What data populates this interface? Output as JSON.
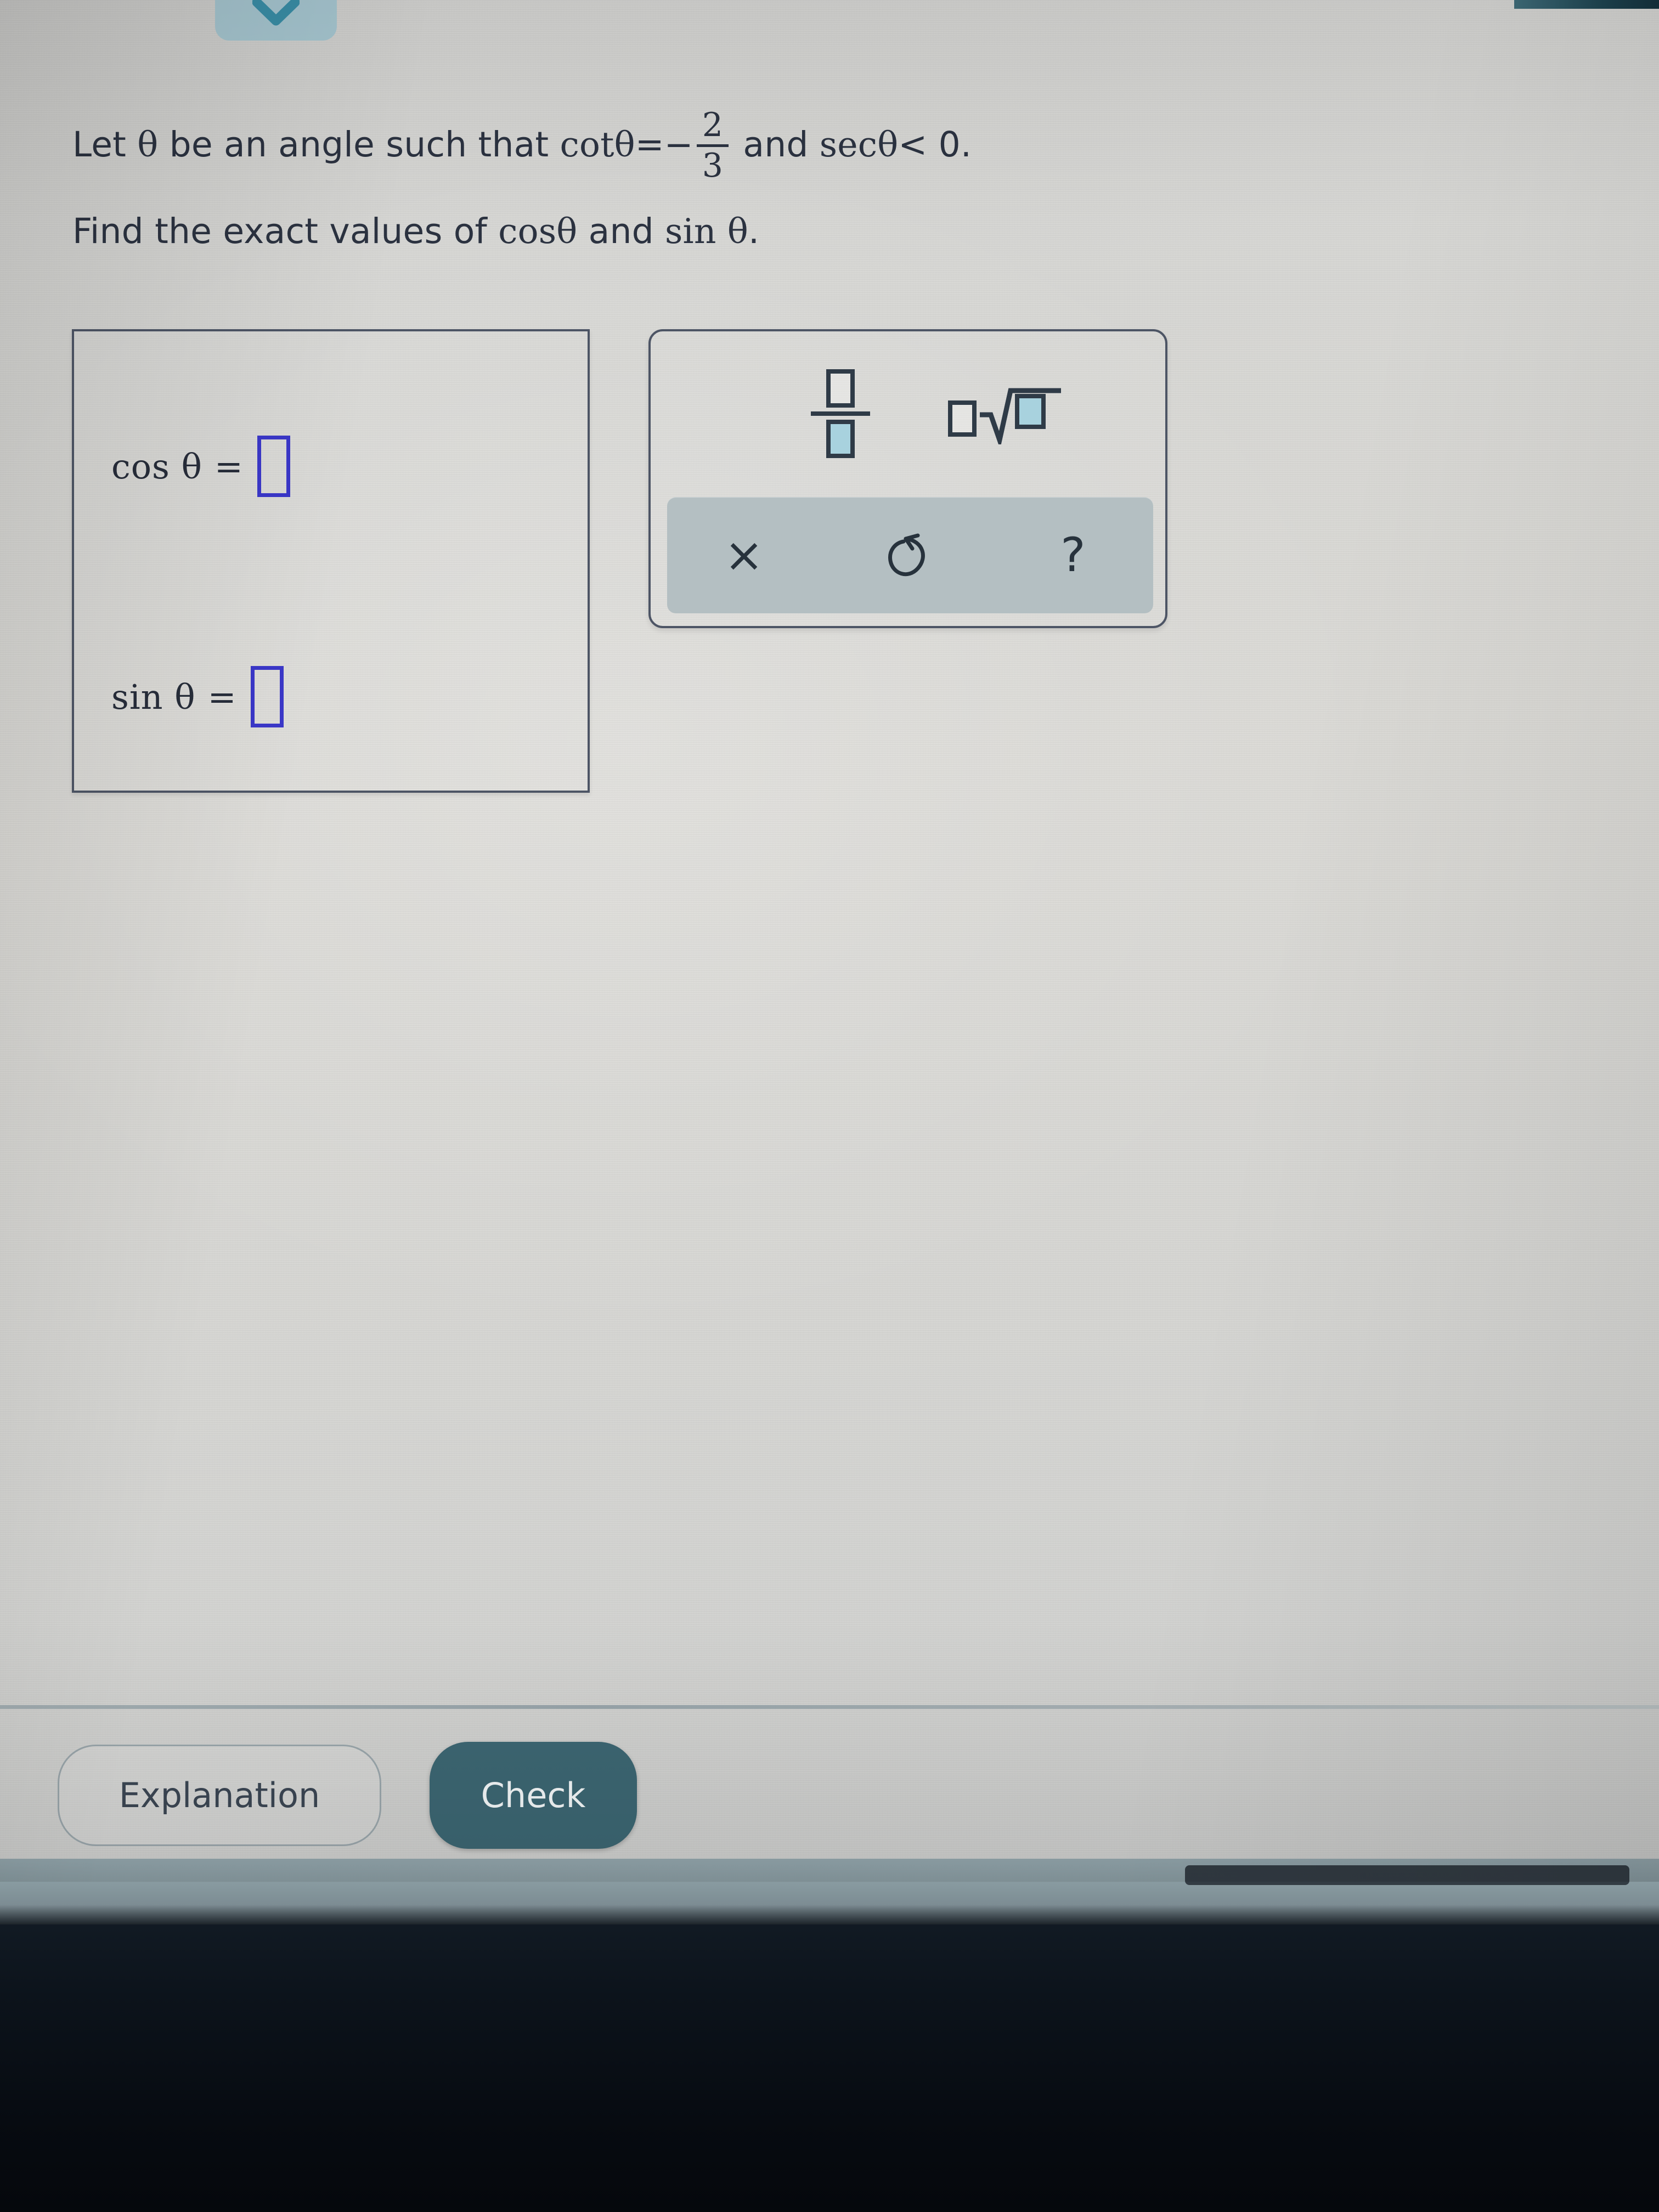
{
  "header": {
    "collapse_icon": "chevron-down-icon"
  },
  "problem": {
    "line1": {
      "prefix": "Let ",
      "theta": "θ",
      "middle": " be an angle such that ",
      "cot_label": "cot",
      "equals": "=",
      "minus": "−",
      "fraction_numerator": "2",
      "fraction_denominator": "3",
      "conjunction": "and",
      "sec_label": "sec",
      "inequality": "< 0."
    },
    "line2": {
      "text_a": "Find the exact values of ",
      "cos_label": "cos",
      "theta": "θ",
      "text_b": " and ",
      "sin_label": "sin",
      "text_c": "."
    }
  },
  "answer_box": {
    "rows": [
      {
        "label": "cos θ",
        "equals": "=",
        "value": "",
        "placeholder": ""
      },
      {
        "label": "sin θ",
        "equals": "=",
        "value": "",
        "placeholder": ""
      }
    ]
  },
  "math_palette": {
    "templates": [
      {
        "name": "fraction-template",
        "icon": "fraction-icon",
        "numerator": "",
        "denominator": ""
      },
      {
        "name": "nth-root-template",
        "icon": "nth-root-icon",
        "index": "",
        "radicand": ""
      }
    ],
    "actions": [
      {
        "name": "clear-button",
        "icon": "close-x-icon",
        "glyph": "×"
      },
      {
        "name": "undo-button",
        "icon": "undo-arrow-icon",
        "glyph": "↺"
      },
      {
        "name": "help-button",
        "icon": "question-mark-icon",
        "glyph": "?"
      }
    ]
  },
  "footer": {
    "explanation_label": "Explanation",
    "check_label": "Check"
  },
  "colors": {
    "screen_background": "#d8d8d5",
    "text": "#2b3240",
    "input_border": "#3a37c8",
    "box_border": "#4d5565",
    "palette_fill": "#a8d2de",
    "action_strip": "#b4bfc2",
    "check_button": "#3c6672",
    "collapse_pill": "#a7c7d1",
    "collapse_chevron": "#3a8fa8",
    "bezel": "#87999f"
  }
}
